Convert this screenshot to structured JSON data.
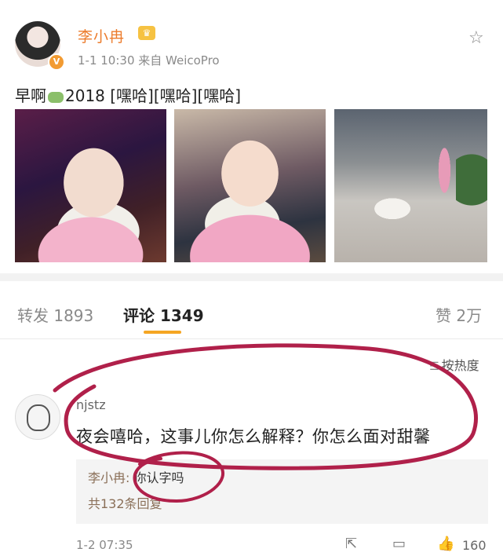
{
  "post": {
    "author": "李小冉",
    "meta": "1-1 10:30  来自 WeicoPro",
    "text_before_emoji": "早啊",
    "text_after_emoji": "2018 [嘿哈][嘿哈][嘿哈]",
    "verified_badge": "V"
  },
  "tabs": {
    "repost": "转发 1893",
    "comments": "评论 1349",
    "likes": "赞 2万"
  },
  "sort": {
    "label": "按热度",
    "icon": "sort-lines-icon"
  },
  "comment": {
    "username": "njstz",
    "text": "夜会嘻哈，这事儿你怎么解释？你怎么面对甜馨",
    "reply_author": "李小冉:",
    "reply_text": " 你认字吗",
    "more_replies": "共132条回复",
    "time": "1-2 07:35",
    "like_count": "160"
  },
  "colors": {
    "accent_orange": "#f5a623",
    "author_orange": "#ec7c2c",
    "annotation_red": "#b0204a"
  }
}
